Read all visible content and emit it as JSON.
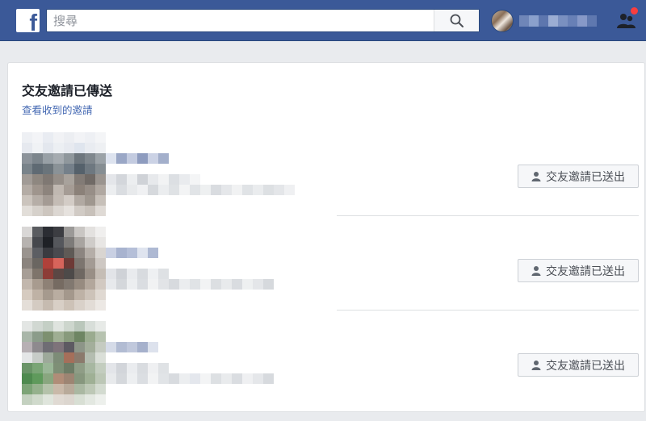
{
  "header": {
    "search_placeholder": "搜尋",
    "brand_color": "#3b5998"
  },
  "icons": {
    "logo": "facebook-logo-icon",
    "search": "search-icon",
    "friends": "friend-requests-icon",
    "sent": "person-added-icon"
  },
  "panel": {
    "title": "交友邀請已傳送",
    "link": "查看收到的邀請"
  },
  "requests": [
    {
      "button_label": "交友邀請已送出"
    },
    {
      "button_label": "交友邀請已送出"
    },
    {
      "button_label": "交友邀請已送出"
    }
  ]
}
